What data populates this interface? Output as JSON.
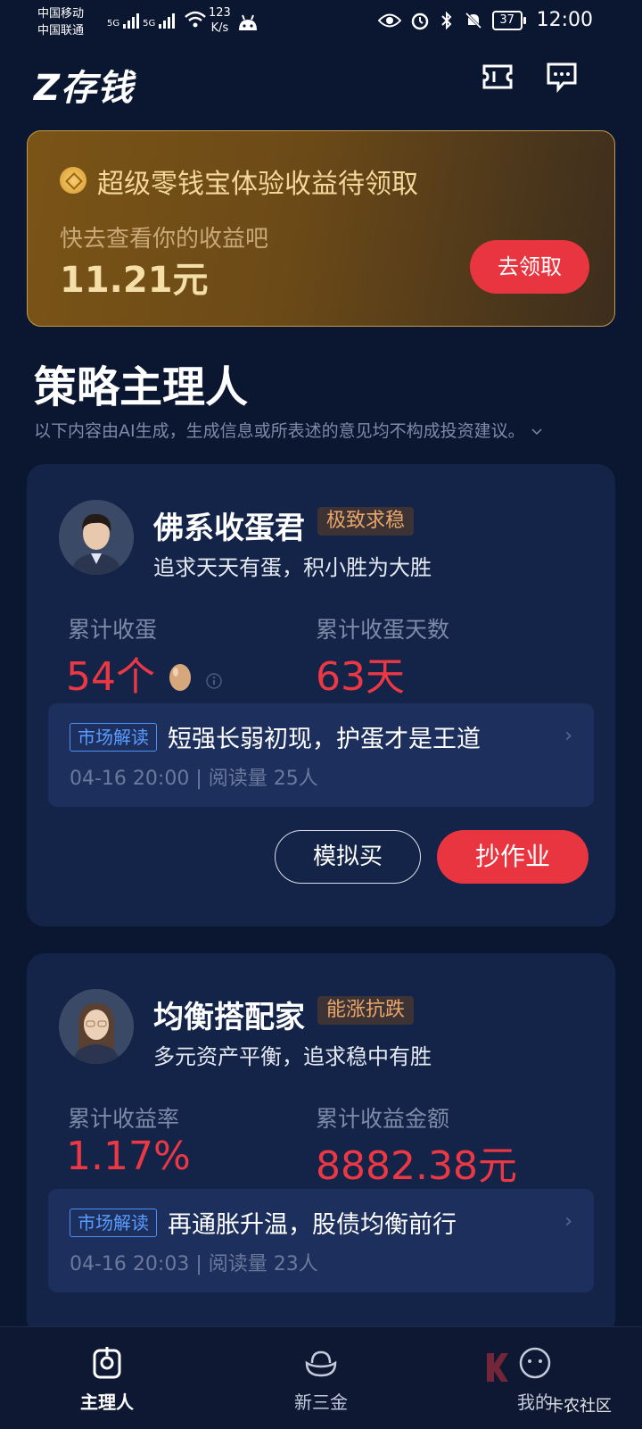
{
  "status_bar": {
    "carrier1": "中国移动",
    "carrier2": "中国联通",
    "net1": "5G",
    "net2": "5G",
    "speed_value": "123",
    "speed_unit": "K/s",
    "battery": "37",
    "time": "12:00"
  },
  "header": {
    "logo": "Z存钱",
    "ticket_icon": "ticket-icon",
    "message_icon": "message-icon"
  },
  "banner": {
    "title": "超级零钱宝体验收益待领取",
    "subtitle": "快去查看你的收益吧",
    "amount": "11.21元",
    "button": "去领取"
  },
  "section": {
    "title": "策略主理人",
    "disclaimer": "以下内容由AI生成，生成信息或所表述的意见均不构成投资建议。",
    "disclaimer_icon": "chevron-down-icon"
  },
  "cards": [
    {
      "name": "佛系收蛋君",
      "tag": "极致求稳",
      "desc": "追求天天有蛋，积小胜为大胜",
      "stat1_label": "累计收蛋",
      "stat1_value": "54个",
      "stat2_label": "累计收蛋天数",
      "stat2_value": "63天",
      "news_badge": "市场解读",
      "news_title": "短强长弱初现，护蛋才是王道",
      "news_meta": "04-16 20:00 | 阅读量 25人",
      "btn_outline": "模拟买",
      "btn_primary": "抄作业"
    },
    {
      "name": "均衡搭配家",
      "tag": "能涨抗跌",
      "desc": "多元资产平衡，追求稳中有胜",
      "stat1_label": "累计收益率",
      "stat1_value": "1.17%",
      "stat2_label": "累计收益金额",
      "stat2_value": "8882.38元",
      "news_badge": "市场解读",
      "news_title": "再通胀升温，股债均衡前行",
      "news_meta": "04-16 20:03 | 阅读量 23人"
    }
  ],
  "bottom_nav": {
    "items": [
      {
        "label": "主理人",
        "icon": "manager-icon",
        "active": true
      },
      {
        "label": "新三金",
        "icon": "ingot-icon",
        "active": false
      },
      {
        "label": "我的",
        "icon": "profile-icon",
        "active": false
      }
    ]
  },
  "watermark": "卡农社区",
  "colors": {
    "background": "#0b1631",
    "card": "#142449",
    "accent_red": "#e9353f",
    "gold": "#f5d79a",
    "tag_text": "#e8a66a"
  }
}
